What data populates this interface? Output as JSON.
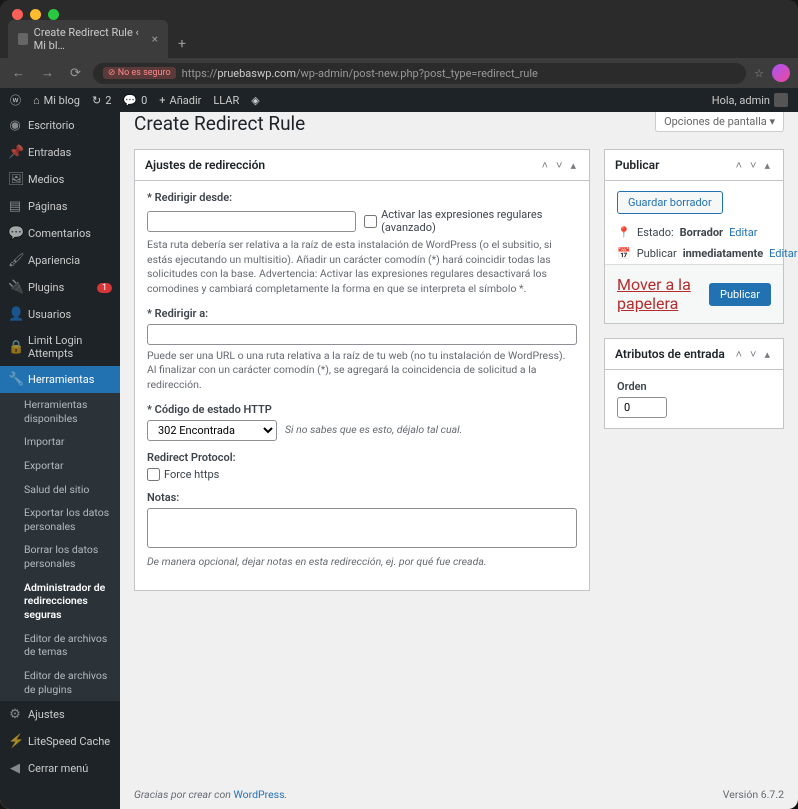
{
  "browser": {
    "tab_title": "Create Redirect Rule ‹ Mi bl…",
    "insecure_label": "No es seguro",
    "url_prefix": "https://",
    "url_domain": "pruebaswp.com",
    "url_path": "/wp-admin/post-new.php?post_type=redirect_rule"
  },
  "adminbar": {
    "site_name": "Mi blog",
    "updates": "2",
    "comments": "0",
    "add_new": "Añadir",
    "llar": "LLAR",
    "howdy": "Hola, admin"
  },
  "menu": {
    "dashboard": "Escritorio",
    "posts": "Entradas",
    "media": "Medios",
    "pages": "Páginas",
    "comments": "Comentarios",
    "appearance": "Apariencia",
    "plugins": "Plugins",
    "plugins_badge": "1",
    "users": "Usuarios",
    "lla": "Limit Login Attempts",
    "tools": "Herramientas",
    "settings": "Ajustes",
    "litespeed": "LiteSpeed Cache",
    "collapse": "Cerrar menú"
  },
  "submenu": {
    "available": "Herramientas disponibles",
    "import": "Importar",
    "export": "Exportar",
    "health": "Salud del sitio",
    "export_personal": "Exportar los datos personales",
    "erase_personal": "Borrar los datos personales",
    "redirect_admin": "Administrador de redirecciones seguras",
    "theme_editor": "Editor de archivos de temas",
    "plugin_editor": "Editor de archivos de plugins"
  },
  "page": {
    "title": "Create Redirect Rule",
    "screen_options": "Opciones de pantalla"
  },
  "metabox": {
    "settings_title": "Ajustes de redirección",
    "redirect_from_label": "* Redirigir desde:",
    "enable_regex": "Activar las expresiones regulares (avanzado)",
    "from_help": "Esta ruta debería ser relativa a la raíz de esta instalación de WordPress (o el subsitio, si estás ejecutando un multisitio). Añadir un carácter comodín (*) hará coincidir todas las solicitudes con la base. Advertencia: Activar las expresiones regulares desactivará los comodines y cambiará completamente la forma en que se interpreta el símbolo *.",
    "redirect_to_label": "* Redirigir a:",
    "to_help": "Puede ser una URL o una ruta relativa a la raíz de tu web (no tu instalación de WordPress). Al finalizar con un carácter comodín (*), se agregará la coincidencia de solicitud a la redirección.",
    "status_label": "* Código de estado HTTP",
    "status_value": "302 Encontrada",
    "status_help": "Si no sabes que es esto, déjalo tal cual.",
    "protocol_label": "Redirect Protocol:",
    "force_https": "Force https",
    "notes_label": "Notas:",
    "notes_help": "De manera opcional, dejar notas en esta redirección, ej. por qué fue creada."
  },
  "publish": {
    "title": "Publicar",
    "save_draft": "Guardar borrador",
    "status_label": "Estado:",
    "status_value": "Borrador",
    "edit": "Editar",
    "schedule_label": "Publicar",
    "schedule_value": "inmediatamente",
    "trash": "Mover a la papelera",
    "publish_btn": "Publicar"
  },
  "attributes": {
    "title": "Atributos de entrada",
    "order_label": "Orden",
    "order_value": "0"
  },
  "footer": {
    "thanks_prefix": "Gracias por crear con ",
    "wp": "WordPress",
    "version": "Versión 6.7.2"
  }
}
